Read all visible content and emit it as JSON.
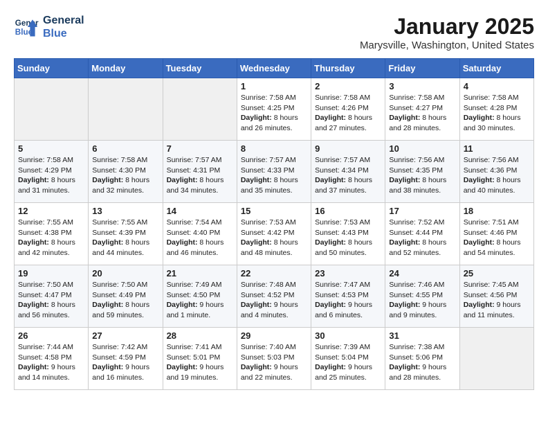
{
  "header": {
    "logo_line1": "General",
    "logo_line2": "Blue",
    "month_title": "January 2025",
    "location": "Marysville, Washington, United States"
  },
  "days_of_week": [
    "Sunday",
    "Monday",
    "Tuesday",
    "Wednesday",
    "Thursday",
    "Friday",
    "Saturday"
  ],
  "weeks": [
    [
      {
        "day": "",
        "content": ""
      },
      {
        "day": "",
        "content": ""
      },
      {
        "day": "",
        "content": ""
      },
      {
        "day": "1",
        "content": "Sunrise: 7:58 AM\nSunset: 4:25 PM\nDaylight: 8 hours and 26 minutes."
      },
      {
        "day": "2",
        "content": "Sunrise: 7:58 AM\nSunset: 4:26 PM\nDaylight: 8 hours and 27 minutes."
      },
      {
        "day": "3",
        "content": "Sunrise: 7:58 AM\nSunset: 4:27 PM\nDaylight: 8 hours and 28 minutes."
      },
      {
        "day": "4",
        "content": "Sunrise: 7:58 AM\nSunset: 4:28 PM\nDaylight: 8 hours and 30 minutes."
      }
    ],
    [
      {
        "day": "5",
        "content": "Sunrise: 7:58 AM\nSunset: 4:29 PM\nDaylight: 8 hours and 31 minutes."
      },
      {
        "day": "6",
        "content": "Sunrise: 7:58 AM\nSunset: 4:30 PM\nDaylight: 8 hours and 32 minutes."
      },
      {
        "day": "7",
        "content": "Sunrise: 7:57 AM\nSunset: 4:31 PM\nDaylight: 8 hours and 34 minutes."
      },
      {
        "day": "8",
        "content": "Sunrise: 7:57 AM\nSunset: 4:33 PM\nDaylight: 8 hours and 35 minutes."
      },
      {
        "day": "9",
        "content": "Sunrise: 7:57 AM\nSunset: 4:34 PM\nDaylight: 8 hours and 37 minutes."
      },
      {
        "day": "10",
        "content": "Sunrise: 7:56 AM\nSunset: 4:35 PM\nDaylight: 8 hours and 38 minutes."
      },
      {
        "day": "11",
        "content": "Sunrise: 7:56 AM\nSunset: 4:36 PM\nDaylight: 8 hours and 40 minutes."
      }
    ],
    [
      {
        "day": "12",
        "content": "Sunrise: 7:55 AM\nSunset: 4:38 PM\nDaylight: 8 hours and 42 minutes."
      },
      {
        "day": "13",
        "content": "Sunrise: 7:55 AM\nSunset: 4:39 PM\nDaylight: 8 hours and 44 minutes."
      },
      {
        "day": "14",
        "content": "Sunrise: 7:54 AM\nSunset: 4:40 PM\nDaylight: 8 hours and 46 minutes."
      },
      {
        "day": "15",
        "content": "Sunrise: 7:53 AM\nSunset: 4:42 PM\nDaylight: 8 hours and 48 minutes."
      },
      {
        "day": "16",
        "content": "Sunrise: 7:53 AM\nSunset: 4:43 PM\nDaylight: 8 hours and 50 minutes."
      },
      {
        "day": "17",
        "content": "Sunrise: 7:52 AM\nSunset: 4:44 PM\nDaylight: 8 hours and 52 minutes."
      },
      {
        "day": "18",
        "content": "Sunrise: 7:51 AM\nSunset: 4:46 PM\nDaylight: 8 hours and 54 minutes."
      }
    ],
    [
      {
        "day": "19",
        "content": "Sunrise: 7:50 AM\nSunset: 4:47 PM\nDaylight: 8 hours and 56 minutes."
      },
      {
        "day": "20",
        "content": "Sunrise: 7:50 AM\nSunset: 4:49 PM\nDaylight: 8 hours and 59 minutes."
      },
      {
        "day": "21",
        "content": "Sunrise: 7:49 AM\nSunset: 4:50 PM\nDaylight: 9 hours and 1 minute."
      },
      {
        "day": "22",
        "content": "Sunrise: 7:48 AM\nSunset: 4:52 PM\nDaylight: 9 hours and 4 minutes."
      },
      {
        "day": "23",
        "content": "Sunrise: 7:47 AM\nSunset: 4:53 PM\nDaylight: 9 hours and 6 minutes."
      },
      {
        "day": "24",
        "content": "Sunrise: 7:46 AM\nSunset: 4:55 PM\nDaylight: 9 hours and 9 minutes."
      },
      {
        "day": "25",
        "content": "Sunrise: 7:45 AM\nSunset: 4:56 PM\nDaylight: 9 hours and 11 minutes."
      }
    ],
    [
      {
        "day": "26",
        "content": "Sunrise: 7:44 AM\nSunset: 4:58 PM\nDaylight: 9 hours and 14 minutes."
      },
      {
        "day": "27",
        "content": "Sunrise: 7:42 AM\nSunset: 4:59 PM\nDaylight: 9 hours and 16 minutes."
      },
      {
        "day": "28",
        "content": "Sunrise: 7:41 AM\nSunset: 5:01 PM\nDaylight: 9 hours and 19 minutes."
      },
      {
        "day": "29",
        "content": "Sunrise: 7:40 AM\nSunset: 5:03 PM\nDaylight: 9 hours and 22 minutes."
      },
      {
        "day": "30",
        "content": "Sunrise: 7:39 AM\nSunset: 5:04 PM\nDaylight: 9 hours and 25 minutes."
      },
      {
        "day": "31",
        "content": "Sunrise: 7:38 AM\nSunset: 5:06 PM\nDaylight: 9 hours and 28 minutes."
      },
      {
        "day": "",
        "content": ""
      }
    ]
  ]
}
